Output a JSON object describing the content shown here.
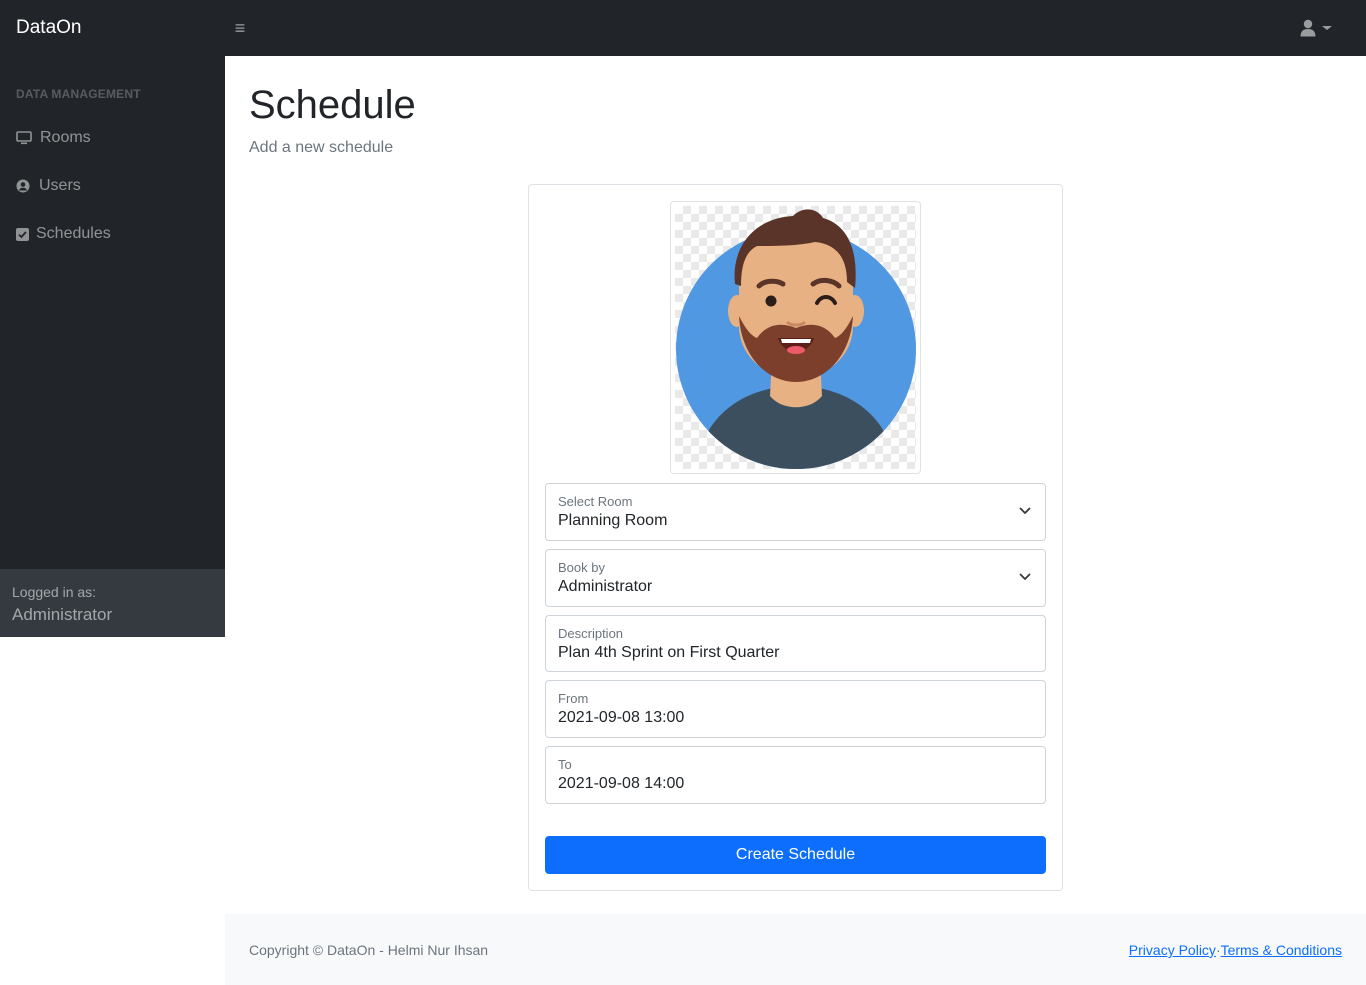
{
  "navbar": {
    "brand": "DataOn",
    "menu_icon": "hamburger-icon",
    "user_icon": "user-icon"
  },
  "sidebar": {
    "heading": "DATA MANAGEMENT",
    "items": [
      {
        "label": "Rooms",
        "icon": "desktop-icon"
      },
      {
        "label": "Users",
        "icon": "user-circle-icon"
      },
      {
        "label": "Schedules",
        "icon": "check-square-icon"
      }
    ],
    "footer": {
      "logged_label": "Logged in as:",
      "user": "Administrator"
    }
  },
  "main": {
    "title": "Schedule",
    "subtitle": "Add a new schedule",
    "form": {
      "room": {
        "label": "Select Room",
        "value": "Planning Room"
      },
      "book_by": {
        "label": "Book by",
        "value": "Administrator"
      },
      "description": {
        "label": "Description",
        "value": "Plan 4th Sprint on First Quarter"
      },
      "from": {
        "label": "From",
        "value": "2021-09-08 13:00"
      },
      "to": {
        "label": "To",
        "value": "2021-09-08 14:00"
      },
      "submit_label": "Create Schedule"
    }
  },
  "footer": {
    "copyright": "Copyright © DataOn - Helmi Nur Ihsan",
    "privacy": "Privacy Policy",
    "separator": "·",
    "terms": "Terms & Conditions"
  },
  "colors": {
    "dark": "#212529",
    "primary": "#0d6efd",
    "avatar_bg": "#5198e3"
  }
}
